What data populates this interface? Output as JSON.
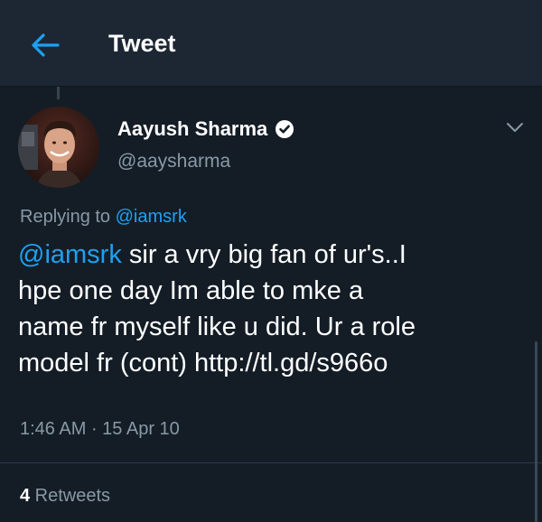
{
  "header": {
    "title": "Tweet",
    "back_icon": "arrow-left-icon"
  },
  "tweet": {
    "author": {
      "display_name": "Aayush Sharma",
      "handle": "@aaysharma",
      "verified": true
    },
    "replying_prefix": "Replying to ",
    "replying_to": "@iamsrk",
    "text_mention": "@iamsrk",
    "text_body": " sir a vry big fan of ur's..I\nhpe one day Im able to mke a\nname fr myself like u did. Ur a role\nmodel fr (cont) http://tl.gd/s966o",
    "time": "1:46 AM",
    "separator": " · ",
    "date": "15 Apr 10",
    "retweet_count": "4",
    "retweet_label": " Retweets"
  },
  "colors": {
    "background": "#141d26",
    "header_bg": "#1c2733",
    "accent": "#1da1f2",
    "secondary_text": "#8899a6"
  }
}
